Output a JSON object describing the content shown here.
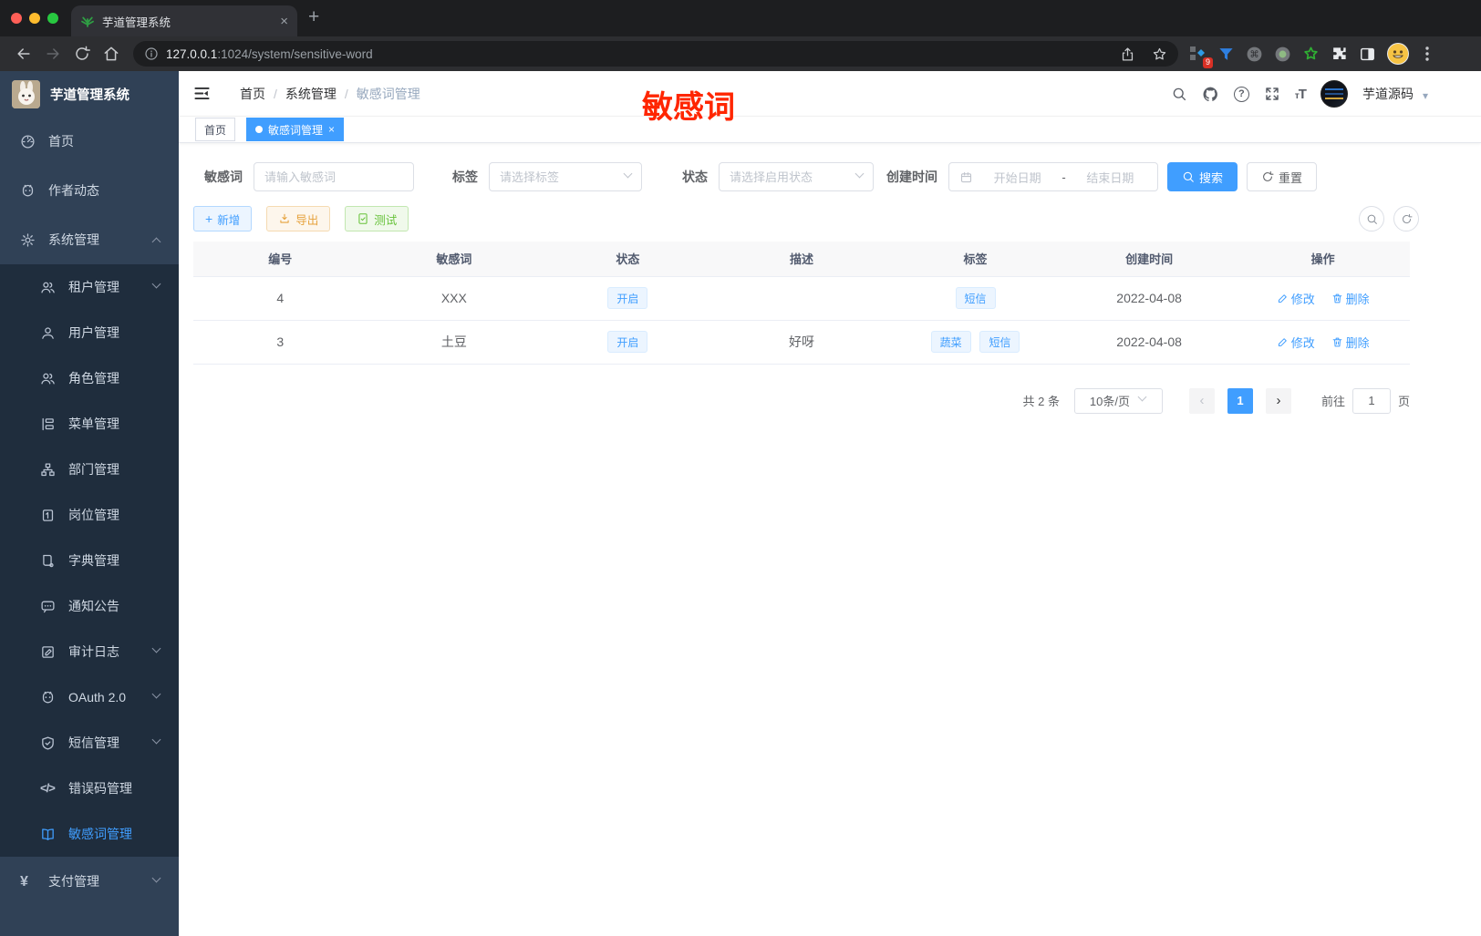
{
  "browser": {
    "tab_title": "芋道管理系统",
    "url_host": "127.0.0.1",
    "url_path": ":1024/system/sensitive-word",
    "ext_badge": "9"
  },
  "annotation": {
    "text": "敏感词"
  },
  "sidebar": {
    "logo_title": "芋道管理系统",
    "home": "首页",
    "author": "作者动态",
    "system": "系统管理",
    "tenant": "租户管理",
    "user": "用户管理",
    "role": "角色管理",
    "menu": "菜单管理",
    "dept": "部门管理",
    "post": "岗位管理",
    "dict": "字典管理",
    "notice": "通知公告",
    "audit": "审计日志",
    "oauth": "OAuth 2.0",
    "sms": "短信管理",
    "errcode": "错误码管理",
    "sensitive": "敏感词管理",
    "pay": "支付管理"
  },
  "breadcrumb": [
    "首页",
    "系统管理",
    "敏感词管理"
  ],
  "header": {
    "user_name": "芋道源码"
  },
  "tags": {
    "home": "首页",
    "active": "敏感词管理"
  },
  "filter": {
    "word_label": "敏感词",
    "word_placeholder": "请输入敏感词",
    "tag_label": "标签",
    "tag_placeholder": "请选择标签",
    "status_label": "状态",
    "status_placeholder": "请选择启用状态",
    "date_label": "创建时间",
    "date_start": "开始日期",
    "date_sep": "-",
    "date_end": "结束日期",
    "search": "搜索",
    "reset": "重置"
  },
  "toolbar": {
    "add": "新增",
    "export": "导出",
    "test": "测试"
  },
  "table": {
    "headers": [
      "编号",
      "敏感词",
      "状态",
      "描述",
      "标签",
      "创建时间",
      "操作"
    ],
    "rows": [
      {
        "id": "4",
        "word": "XXX",
        "status": "开启",
        "desc": "",
        "tags": [
          "短信"
        ],
        "created": "2022-04-08"
      },
      {
        "id": "3",
        "word": "土豆",
        "status": "开启",
        "desc": "好呀",
        "tags": [
          "蔬菜",
          "短信"
        ],
        "created": "2022-04-08"
      }
    ],
    "edit": "修改",
    "delete": "删除"
  },
  "pagination": {
    "total": "共 2 条",
    "size": "10条/页",
    "page": "1",
    "goto": "前往",
    "unit": "页",
    "goto_value": "1"
  },
  "icons": {
    "errcode": "</>",
    "yen": "¥",
    "plus": "+",
    "close": "×",
    "prev": "‹",
    "next": "›",
    "question": "?",
    "cmd": "⌘",
    "t_small": "т",
    "t_big": "T"
  },
  "colors": {
    "accent": "#409eff",
    "warning": "#e6a23c",
    "success": "#67c23a",
    "annotation_red": "#ff2600",
    "sidebar": "#304156",
    "sidebar_sub": "#1f2d3d"
  }
}
